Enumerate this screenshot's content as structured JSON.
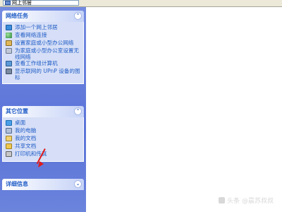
{
  "address_bar": {
    "text": "网上邻居",
    "icon": "network-places-icon"
  },
  "panels": [
    {
      "title": "网络任务",
      "toggle": "⌃",
      "items": [
        {
          "label": "添加一个网上邻居",
          "icon": "add-network-place-icon"
        },
        {
          "label": "查看网络连接",
          "icon": "network-connections-icon"
        },
        {
          "label": "设置家庭或小型办公网络",
          "icon": "home-network-icon"
        },
        {
          "label": "为家庭或小型办公室设置无线网络",
          "icon": "wireless-network-icon"
        },
        {
          "label": "查看工作组计算机",
          "icon": "workgroup-icon"
        },
        {
          "label": "显示联网的 UPnP 设备的图标",
          "icon": "upnp-device-icon"
        }
      ]
    },
    {
      "title": "其它位置",
      "toggle": "⌃",
      "items": [
        {
          "label": "桌面",
          "icon": "desktop-icon"
        },
        {
          "label": "我的电脑",
          "icon": "my-computer-icon"
        },
        {
          "label": "我的文档",
          "icon": "my-documents-icon"
        },
        {
          "label": "共享文档",
          "icon": "shared-documents-icon"
        },
        {
          "label": "打印机和传真",
          "icon": "printer-icon"
        }
      ]
    },
    {
      "title": "详细信息",
      "toggle": "⌄"
    }
  ],
  "watermark": "头条 @晨苏叔叔",
  "annotation_color": "#e21b1b"
}
